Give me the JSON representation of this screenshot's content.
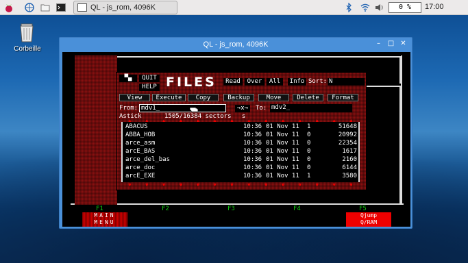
{
  "taskbar": {
    "window_title": "QL - js_rom, 4096K",
    "cpu": "0 %",
    "clock": "17:00"
  },
  "desktop": {
    "trash_label": "Corbeille"
  },
  "window": {
    "title": "QL - js_rom, 4096K"
  },
  "files": {
    "quit": "QUIT",
    "help": "HELP",
    "title": "FILES",
    "read": "Read",
    "over": "Over",
    "all": "All",
    "info": "Info",
    "sort": "Sort:",
    "sort_val": "N",
    "actions": [
      "View",
      "Execute",
      "Copy",
      "Backup",
      "Move",
      "Delete",
      "Format"
    ],
    "from_label": "From:",
    "from_value": "mdv1_",
    "xchg": "→x→",
    "to_label": "To:",
    "to_value": "mdv2_",
    "device": "Astick",
    "sectors": "1505/16384 sectors",
    "sectors_s": "s",
    "rows": [
      {
        "name": "ABACUS",
        "time": "10:36",
        "date": "01 Nov 11",
        "v": "1",
        "size": "51648"
      },
      {
        "name": "ABBA_HOB",
        "time": "10:36",
        "date": "01 Nov 11",
        "v": "0",
        "size": "20992"
      },
      {
        "name": "arce_asm",
        "time": "10:36",
        "date": "01 Nov 11",
        "v": "0",
        "size": "22354"
      },
      {
        "name": "arcE_BAS",
        "time": "10:36",
        "date": "01 Nov 11",
        "v": "0",
        "size": "1617"
      },
      {
        "name": "arce_del_bas",
        "time": "10:36",
        "date": "01 Nov 11",
        "v": "0",
        "size": "2160"
      },
      {
        "name": "arce_doc",
        "time": "10:36",
        "date": "01 Nov 11",
        "v": "0",
        "size": "6144"
      },
      {
        "name": "arcE_EXE",
        "time": "10:36",
        "date": "01 Nov 11",
        "v": "1",
        "size": "3580"
      }
    ]
  },
  "fkeys": {
    "f1": "F1",
    "f2": "F2",
    "f3": "F3",
    "f4": "F4",
    "f5": "F5",
    "main1": "MAIN",
    "main2": "MENU",
    "q1": "Qjump",
    "q2": "Q/RAM"
  }
}
